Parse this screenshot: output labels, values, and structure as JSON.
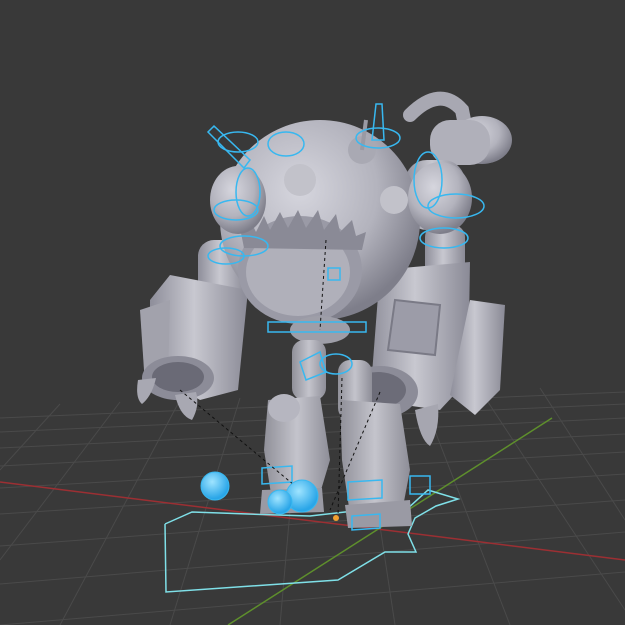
{
  "viewport": {
    "background": "#393939",
    "grid_color": "#4a4a4a",
    "x_axis_color": "#9c2f33",
    "y_axis_color": "#5e8f2c",
    "origin_color": "#f0a030"
  },
  "model": {
    "mesh_color": "#b8b8c2",
    "mesh_shadow": "#8a8a96",
    "rig_color": "#38b8f0",
    "rig_fill": "#6fd0ff",
    "selection_outline": "#7fe0e8"
  },
  "icons": {
    "origin": "origin-dot-icon",
    "ik_target": "sphere-control-icon"
  }
}
